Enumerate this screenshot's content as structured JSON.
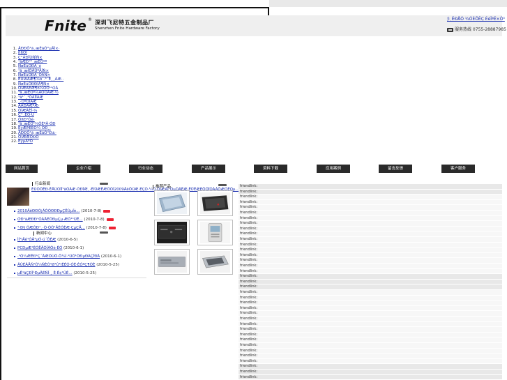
{
  "header": {
    "logo_word": "Fnite",
    "logo_mark": "®",
    "company_cn": "深圳飞尼特五金制品厂",
    "company_en": "Shenzhen Fnite Hardware Factory",
    "top_links": "¦ì¸ÊÐÅÓ ¼ÓÈÕÊÇ ÉèÎªÊ×Ò³",
    "hotline": "服务热线 0755-28887985"
  },
  "nav_list": [
    "ÄÐÐÔ¹ã¸æÉãÓ°µÄÌ×·",
    "ßßÓÏ",
    "Ç°ÁÐÏÙÑÎÑ×",
    "¹ãÆÐ°²¸æÊÕºº",
    "ÑøÉúÓÐÀ´ó",
    "¹ã¸æÌÖÂÛºÃÎÑ×",
    "ÑøÉúÓÐÀ´ÓÀÑ×",
    "ÈÚÎÂÅÆ¶¾ó´·¹´É¸¸ÃÆ··",
    "ÑøÉúÓÐÐÎÄ¶Ñ×",
    "ÓÍÆÁÉÆ¶ó¾ÔÓ¹²ÓÅ",
    "¹ã¸æÊÕº¾ÀÔÓÅÆ·½",
    "¹ã¹´¸¹ÒÃÎÎÀÆ",
    "¸·ÒºÓÏÀÆ",
    "ÃÅÐÄÆºÆ·",
    "ÓÍÆÃÈÍ·¾",
    "Ç°¸ÈÕ·Ú",
    "ÓßÐ¹Òé·",
    "¹ã¸æÊÕ³¾ÔÉºÂ·ÓÐ",
    "ÉýÆÞÈËÓ¼ ÖÐ¸·",
    "ÅÐÐÔ¹ã¸æÉãÓ°Ð±·",
    "ÓÍÆÆÖÐÓ",
    "ÉýµÂºÖ"
  ],
  "menu": [
    "网站首页",
    "企业介绍",
    "行业动态",
    "产品展示",
    "资料下载",
    "应用案例",
    "留言反馈",
    "客户服务"
  ],
  "news": {
    "title": "行业新闻",
    "headline": "ÈÚÓÕÊÐ·ÊÅÚÓÌÎ¹ãÒÃÆ·ÓÐÏÆ¸·ÉîÛÆÊÆÕÒÌ2009ÄêÔÚÆ·ÉÇÒ·¼Ó·ÕÏÆÁÍ¹ÓµÒÃËÆ·ÊÜÊÆÈÔÕÏÓÁÀÔÆÓÊÕµ...",
    "items": [
      {
        "title": "2010ÄêÐÐÓ¦ÃÒÓÐÐÐµÇÊÙµÍè...",
        "date": "(2010-7-8)",
        "new": true
      },
      {
        "title": "ÓÐ¹ãÆÐÐ¹ÓÀÄÉÓÐµÇµ·ÆÓ¹¹ÚÊ...",
        "date": "(2010-7-8)",
        "new": true
      },
      {
        "title": "¹·Ð§ ÓÆÓÐ¹¸·Ò·ÓÕ¹ÂÈÓÈÆ·ÇµÇÄ...",
        "date": "(2010-7-8)",
        "new": true
      }
    ]
  },
  "msg": {
    "title": "新闻中心",
    "items": [
      {
        "title": "ÌÍ¹ïÄê¹ÓÂ³µÓ·ú´ÔÈÆ",
        "date": "(2010-6-5)"
      },
      {
        "title": "PCDµÆ¹ÈÓËÄÓÎÀÕè·ÈÓ",
        "date": "(2010-6-1)"
      },
      {
        "title": "·¹Ó¼ÆÊÐ¹Ç´ÄÆÓÙÕ·Ö¼Í·¹ÙÓ¹ÒÐµÐÀÇÏÐÄ",
        "date": "(2010-6-1)"
      },
      {
        "title": "ÃÙÈÃÄÑ¹Õ¼ÑÈÓ¹Ø¹Ù¹ïÈÈÓ·ÓÈ·ÈÓºÇ¶ÓÈ",
        "date": "(2010-5-25)"
      },
      {
        "title": "µÊ¹ãÇÐÏ¹ÐµÄÉÑÏ·¸ Ê·Ê¢¹ÛÊ...",
        "date": "(2010-5-25)"
      }
    ]
  },
  "products": {
    "title": "推荐产品"
  },
  "friendlinks": {
    "label": "friendlink:",
    "count": 37
  }
}
